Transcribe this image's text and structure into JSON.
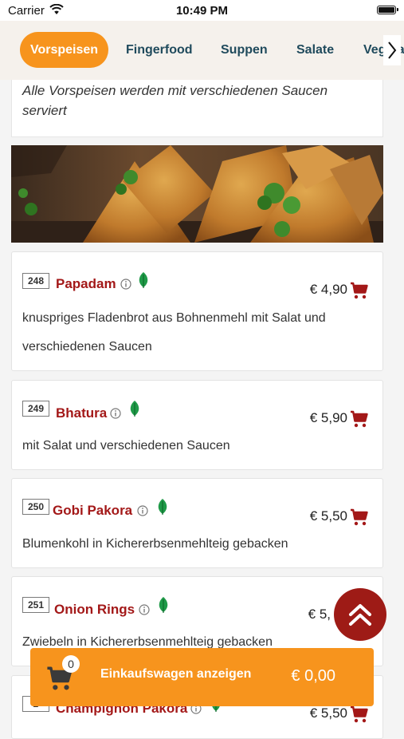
{
  "status_bar": {
    "carrier": "Carrier",
    "time": "10:49 PM"
  },
  "tabs": {
    "items": [
      {
        "label": "Vorspeisen",
        "active": true
      },
      {
        "label": "Fingerfood",
        "active": false
      },
      {
        "label": "Suppen",
        "active": false
      },
      {
        "label": "Salate",
        "active": false
      },
      {
        "label": "Vegetarisch",
        "active": false
      }
    ]
  },
  "intro": {
    "text": "Alle Vorspeisen werden mit verschiedenen Saucen serviert"
  },
  "dishes": [
    {
      "number": "248",
      "name": "Papadam",
      "price": "€ 4,90",
      "description": "knuspriges Fladenbrot aus Bohnenmehl mit Salat und verschiedenen Saucen",
      "vegetarian": true
    },
    {
      "number": "249",
      "name": "Bhatura",
      "price": "€ 5,90",
      "description": "mit Salat und verschiedenen Saucen",
      "vegetarian": true
    },
    {
      "number": "250",
      "name": "Gobi Pakora",
      "price": "€ 5,50",
      "description": "Blumenkohl in Kichererbsenmehlteig gebacken",
      "vegetarian": true
    },
    {
      "number": "251",
      "name": "Onion Rings",
      "price": "€ 5,",
      "description": "Zwiebeln in Kichererbsenmehlteig gebacken",
      "vegetarian": true
    },
    {
      "number": "2",
      "name": "Champignon Pakora",
      "price": "€ 5,50",
      "description": "",
      "vegetarian": true
    }
  ],
  "cart": {
    "count": "0",
    "label": "Einkaufswagen anzeigen",
    "total": "€ 0,00"
  },
  "colors": {
    "accent": "#f7941d",
    "dish_name": "#a31818",
    "tab_text": "#1f4a5c",
    "fab": "#9e1b16",
    "leaf": "#1f9a48"
  },
  "icons": {
    "info": "info-icon",
    "vegetarian": "leaf-icon",
    "add_to_cart": "cart-icon",
    "scroll_top": "double-chevron-up-icon",
    "tabs_next": "chevron-right-icon"
  }
}
